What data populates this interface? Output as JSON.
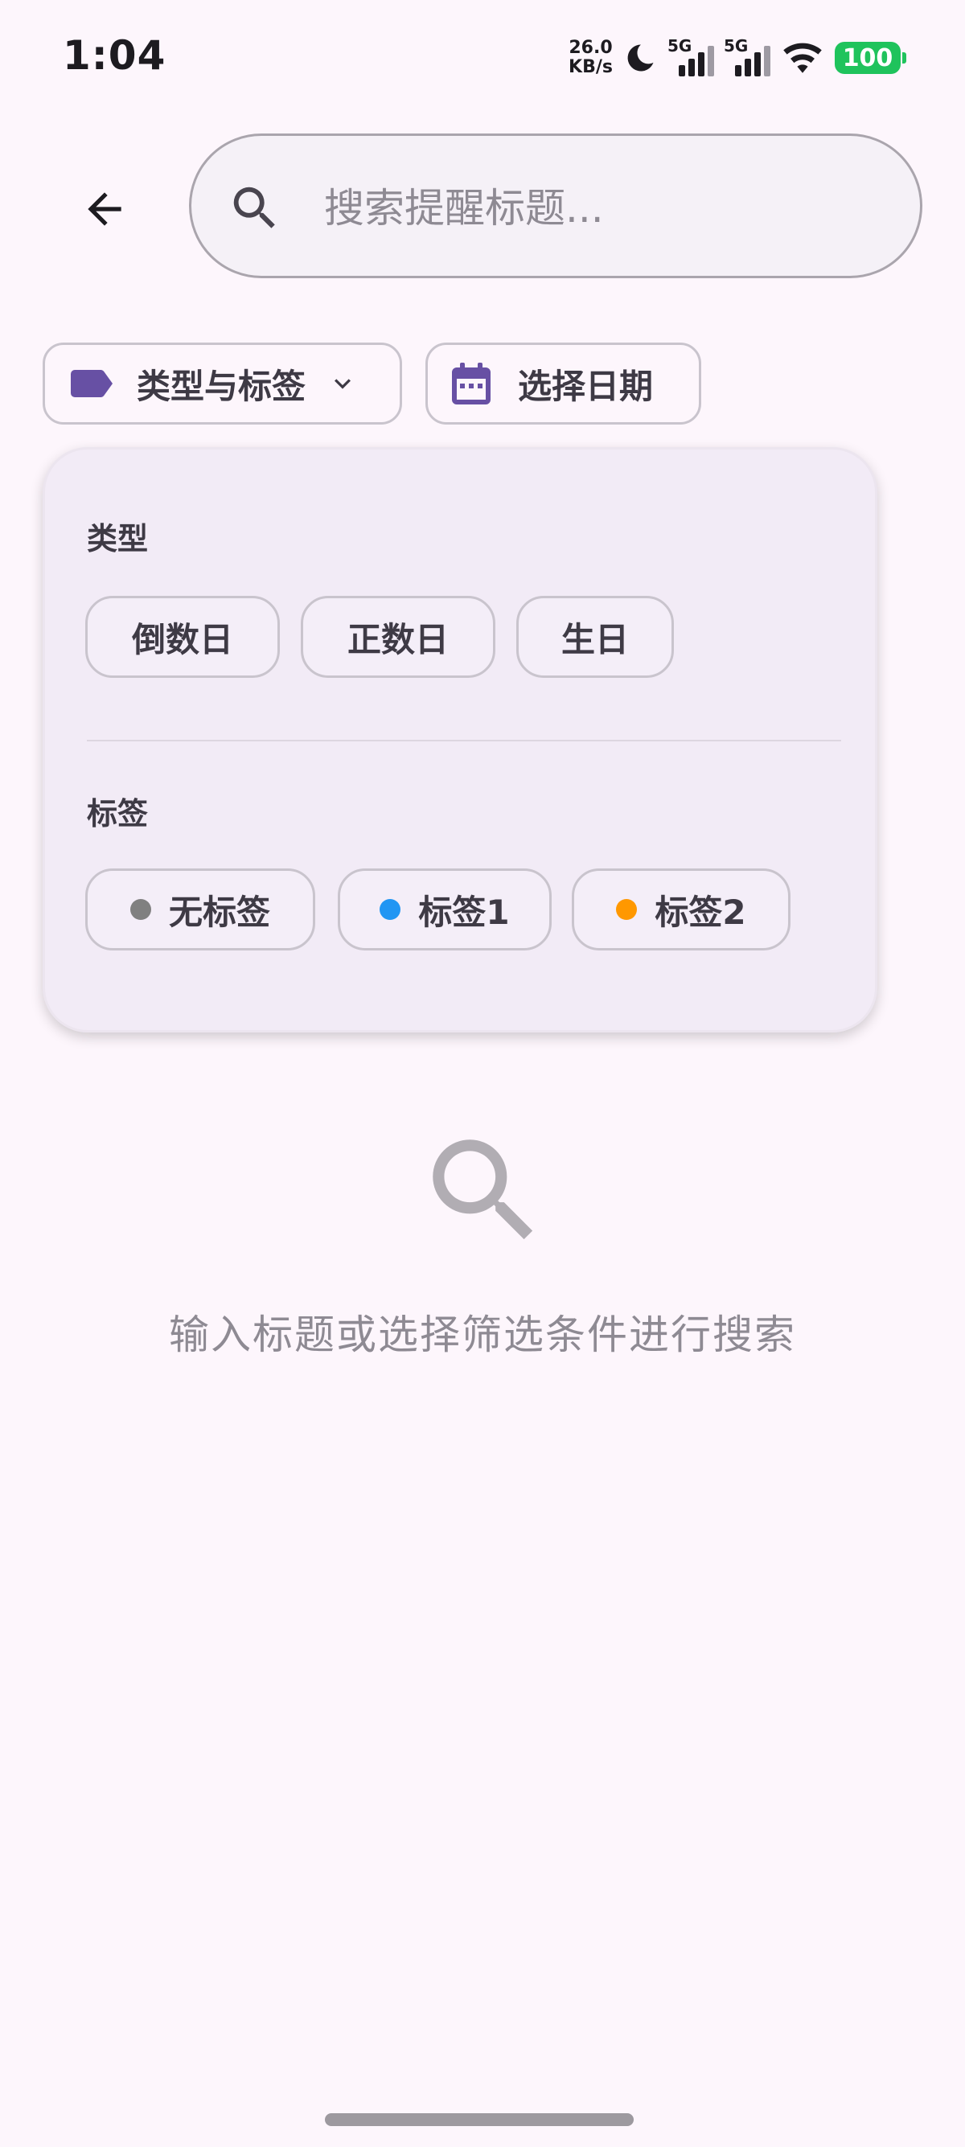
{
  "status_bar": {
    "time": "1:04",
    "net_speed_value": "26.0",
    "net_speed_unit": "KB/s",
    "sim1_label": "5G",
    "sim2_label": "5G",
    "battery": "100"
  },
  "header": {
    "search_placeholder": "搜索提醒标题..."
  },
  "filters": {
    "type_chip_label": "类型与标签",
    "date_chip_label": "选择日期"
  },
  "panel": {
    "type_section_title": "类型",
    "types": [
      "倒数日",
      "正数日",
      "生日"
    ],
    "tag_section_title": "标签",
    "tags": [
      {
        "label": "无标签",
        "color": "#808080"
      },
      {
        "label": "标签1",
        "color": "#2196f3"
      },
      {
        "label": "标签2",
        "color": "#ff9800"
      }
    ]
  },
  "empty_state": {
    "icon": "search-icon",
    "message": "输入标题或选择筛选条件进行搜索"
  },
  "colors": {
    "accent": "#6750a4",
    "background": "#fdf6fc",
    "battery": "#1fc35c"
  }
}
